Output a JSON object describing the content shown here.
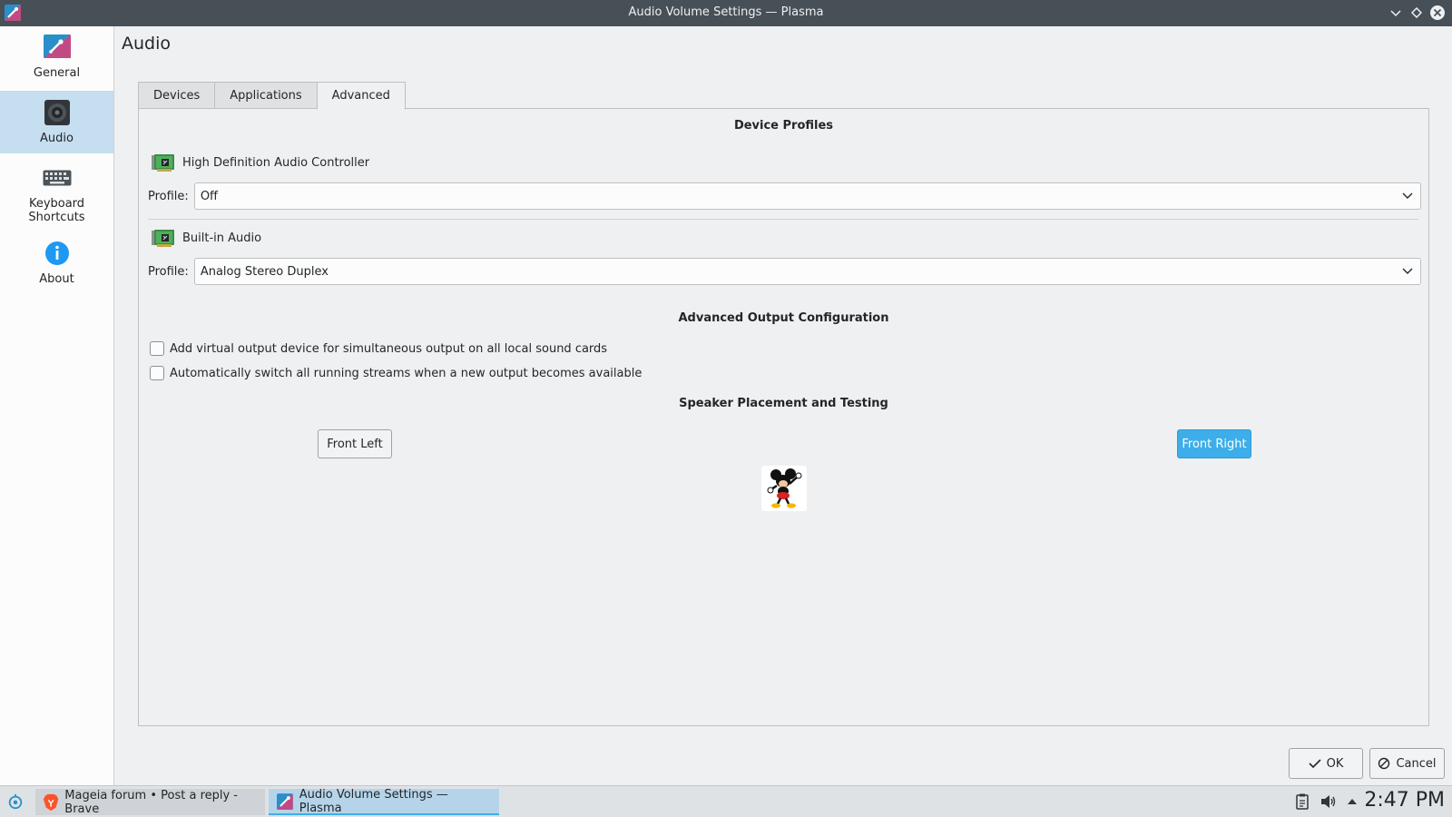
{
  "window": {
    "title": "Audio Volume Settings — Plasma"
  },
  "sidebar": {
    "items": [
      {
        "label": "General",
        "icon": "general-icon"
      },
      {
        "label": "Audio",
        "icon": "speaker-icon",
        "active": true
      },
      {
        "label_line1": "Keyboard",
        "label_line2": "Shortcuts",
        "icon": "keyboard-icon"
      },
      {
        "label": "About",
        "icon": "info-icon"
      }
    ]
  },
  "page": {
    "title": "Audio"
  },
  "tabs": [
    {
      "label": "Devices"
    },
    {
      "label": "Applications"
    },
    {
      "label": "Advanced",
      "active": true
    }
  ],
  "device_profiles": {
    "heading": "Device Profiles",
    "devices": [
      {
        "name": "High Definition Audio Controller",
        "profile_label": "Profile:",
        "profile_value": "Off"
      },
      {
        "name": "Built-in Audio",
        "profile_label": "Profile:",
        "profile_value": "Analog Stereo Duplex"
      }
    ]
  },
  "advanced_output": {
    "heading": "Advanced Output Configuration",
    "options": [
      {
        "label": "Add virtual output device for simultaneous output on all local sound cards",
        "checked": false
      },
      {
        "label": "Automatically switch all running streams when a new output becomes available",
        "checked": false
      }
    ]
  },
  "speaker_testing": {
    "heading": "Speaker Placement and Testing",
    "front_left": "Front Left",
    "front_right": "Front Right"
  },
  "dialog_buttons": {
    "ok": "OK",
    "cancel": "Cancel"
  },
  "taskbar": {
    "tasks": [
      {
        "label": "Mageia forum • Post a reply - Brave",
        "icon": "brave-icon"
      },
      {
        "label": "Audio Volume Settings — Plasma",
        "icon": "plasma-settings-icon",
        "active": true
      }
    ],
    "clock": "2:47 PM"
  },
  "colors": {
    "accent": "#3daee9",
    "titlebar": "#475057",
    "sidebar_active": "#c5def0"
  }
}
